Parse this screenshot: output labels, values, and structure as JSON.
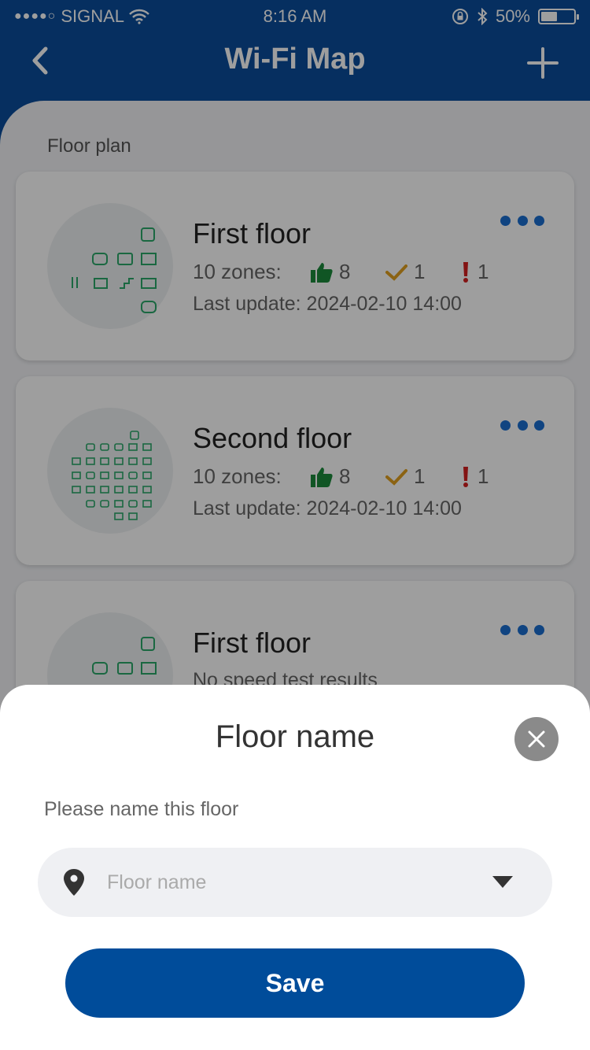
{
  "status_bar": {
    "signal_dots": "●●●●○",
    "carrier": "SIGNAL",
    "time": "8:16 AM",
    "battery_text": "50%",
    "battery_level": 0.5
  },
  "header": {
    "title": "Wi-Fi Map",
    "back_icon": "chevron-left-icon",
    "add_icon": "plus-icon"
  },
  "section_label": "Floor plan",
  "floors": [
    {
      "title": "First floor",
      "zones_label": "10 zones:",
      "good": "8",
      "ok": "1",
      "bad": "1",
      "update": "Last update: 2024-02-10 14:00"
    },
    {
      "title": "Second floor",
      "zones_label": "10 zones:",
      "good": "8",
      "ok": "1",
      "bad": "1",
      "update": "Last update: 2024-02-10 14:00"
    },
    {
      "title": "First floor",
      "subtitle": "No speed test results"
    }
  ],
  "colors": {
    "header_blue": "#0a4d9c",
    "accent_blue": "#1a6fd0",
    "good_green": "#1a8a3a",
    "ok_yellow": "#e0a020",
    "bad_red": "#d42020",
    "room_green": "#2aa86a"
  },
  "sheet": {
    "title": "Floor name",
    "label": "Please name this floor",
    "placeholder": "Floor name",
    "save_label": "Save",
    "close_icon": "close-icon",
    "pin_icon": "location-pin-icon",
    "dropdown_icon": "caret-down-icon"
  }
}
